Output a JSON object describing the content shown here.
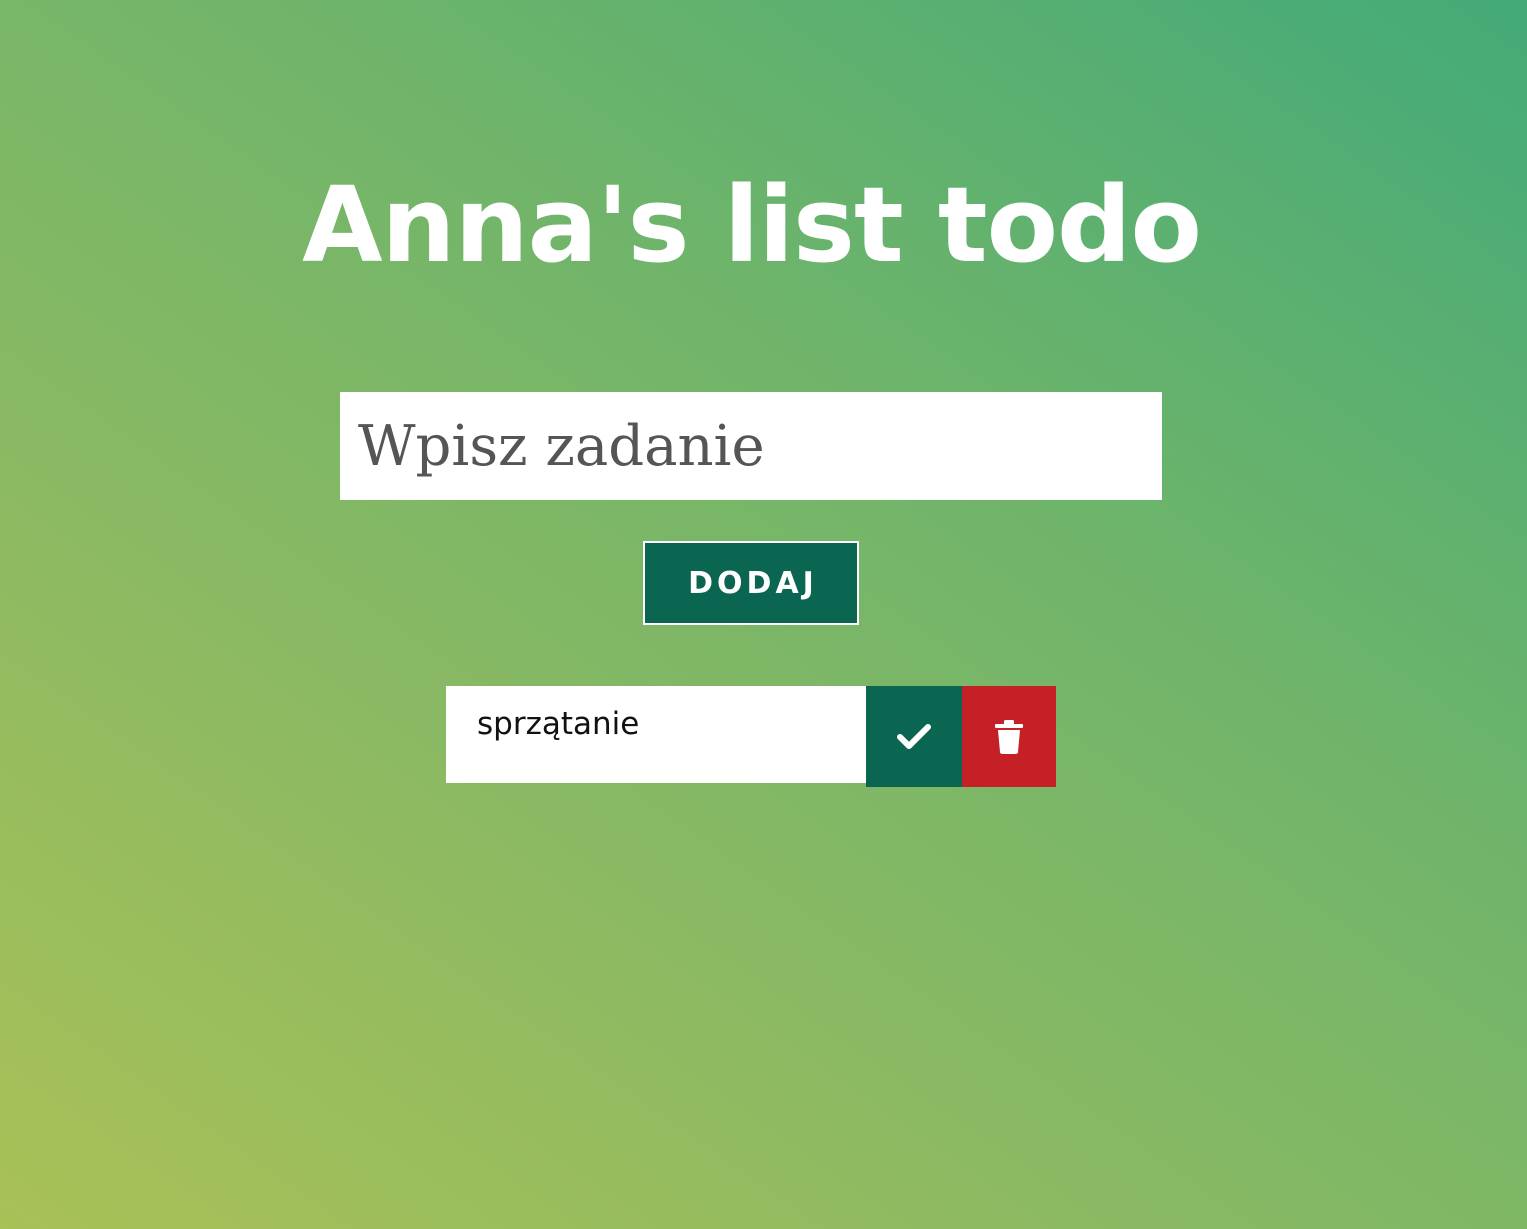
{
  "header": {
    "title": "Anna's list todo"
  },
  "form": {
    "placeholder": "Wpisz zadanie",
    "add_label": "DODAJ"
  },
  "todos": [
    {
      "text": "sprzątanie",
      "complete_icon": "check-icon",
      "delete_icon": "trash-icon"
    }
  ],
  "colors": {
    "primary": "#0a6650",
    "danger": "#c52026",
    "gradient_start": "#a9c157",
    "gradient_end": "#43aa78"
  }
}
